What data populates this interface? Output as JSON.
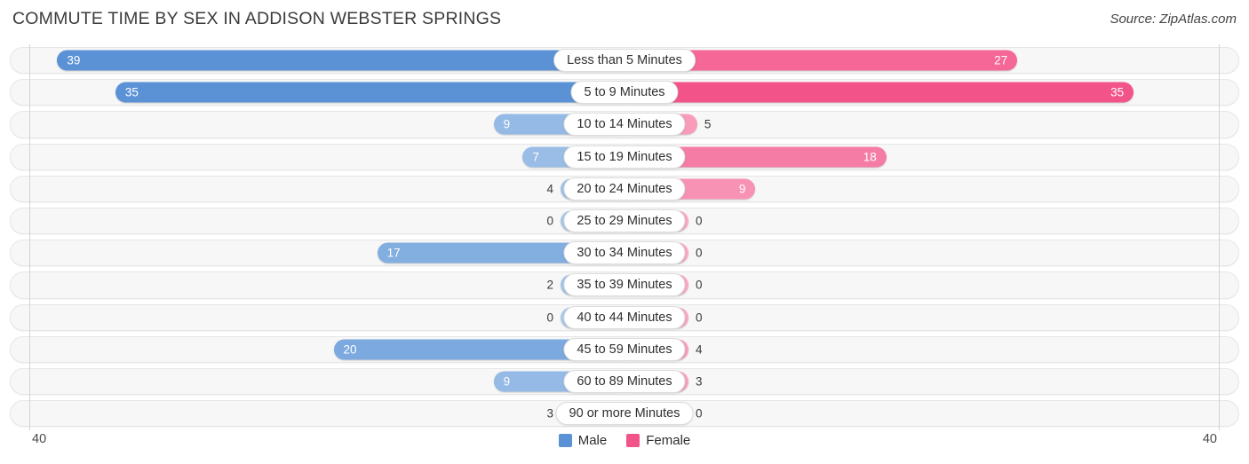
{
  "header": {
    "title": "COMMUTE TIME BY SEX IN ADDISON WEBSTER SPRINGS",
    "source": "Source: ZipAtlas.com"
  },
  "axis": {
    "left_tick": "40",
    "right_tick": "40"
  },
  "legend": {
    "items": [
      {
        "label": "Male",
        "color": "#5b92d6"
      },
      {
        "label": "Female",
        "color": "#f2548a"
      }
    ]
  },
  "colors": {
    "male_strong": "#5b92d6",
    "male_light": "#a8c8ea",
    "female_strong": "#f2548a",
    "female_light": "#f9a8c2",
    "track_bg": "#f7f7f7",
    "track_border": "#e6e6e6",
    "axis_line": "#d3d3d7"
  },
  "chart_data": {
    "type": "bar",
    "title": "COMMUTE TIME BY SEX IN ADDISON WEBSTER SPRINGS",
    "orientation": "horizontal-diverging",
    "xlabel": "",
    "ylabel": "",
    "xlim": [
      40,
      40
    ],
    "grid": false,
    "legend_position": "bottom-center",
    "categories": [
      "Less than 5 Minutes",
      "5 to 9 Minutes",
      "10 to 14 Minutes",
      "15 to 19 Minutes",
      "20 to 24 Minutes",
      "25 to 29 Minutes",
      "30 to 34 Minutes",
      "35 to 39 Minutes",
      "40 to 44 Minutes",
      "45 to 59 Minutes",
      "60 to 89 Minutes",
      "90 or more Minutes"
    ],
    "series": [
      {
        "name": "Male",
        "values": [
          39,
          35,
          9,
          7,
          4,
          0,
          17,
          2,
          0,
          20,
          9,
          3
        ]
      },
      {
        "name": "Female",
        "values": [
          27,
          35,
          5,
          18,
          9,
          0,
          0,
          0,
          0,
          4,
          3,
          0
        ]
      }
    ],
    "rows": [
      {
        "category": "Less than 5 Minutes",
        "male": 39,
        "female": 27
      },
      {
        "category": "5 to 9 Minutes",
        "male": 35,
        "female": 35
      },
      {
        "category": "10 to 14 Minutes",
        "male": 9,
        "female": 5
      },
      {
        "category": "15 to 19 Minutes",
        "male": 7,
        "female": 18
      },
      {
        "category": "20 to 24 Minutes",
        "male": 4,
        "female": 9
      },
      {
        "category": "25 to 29 Minutes",
        "male": 0,
        "female": 0
      },
      {
        "category": "30 to 34 Minutes",
        "male": 17,
        "female": 0
      },
      {
        "category": "35 to 39 Minutes",
        "male": 2,
        "female": 0
      },
      {
        "category": "40 to 44 Minutes",
        "male": 0,
        "female": 0
      },
      {
        "category": "45 to 59 Minutes",
        "male": 20,
        "female": 4
      },
      {
        "category": "60 to 89 Minutes",
        "male": 9,
        "female": 3
      },
      {
        "category": "90 or more Minutes",
        "male": 3,
        "female": 0
      }
    ]
  }
}
